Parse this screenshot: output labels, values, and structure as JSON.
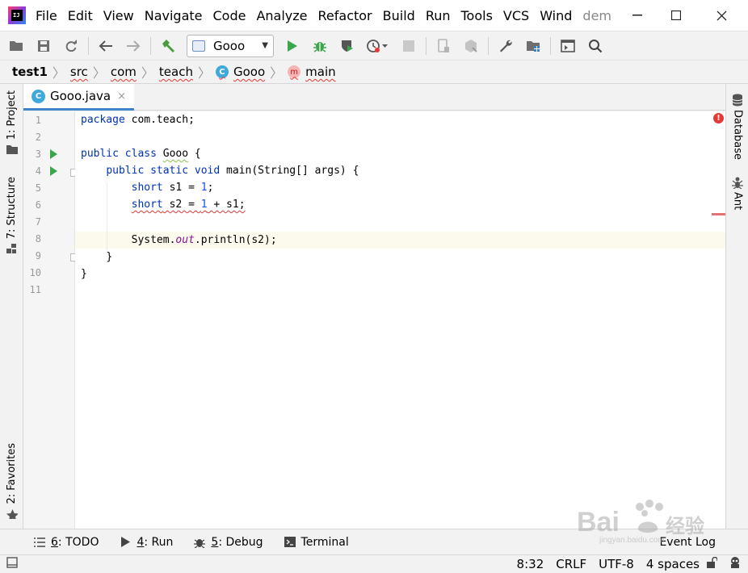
{
  "menubar": {
    "items": [
      "File",
      "Edit",
      "View",
      "Navigate",
      "Code",
      "Analyze",
      "Refactor",
      "Build",
      "Run",
      "Tools",
      "VCS",
      "Wind"
    ],
    "title_fragment": "dem"
  },
  "toolbar": {
    "run_config": "Gooo"
  },
  "breadcrumb": {
    "project": "test1",
    "items": [
      "src",
      "com",
      "teach"
    ],
    "class_badge": "C",
    "class_name": "Gooo",
    "method_badge": "m",
    "method_name": "main"
  },
  "left_stripe": {
    "project": "1: Project",
    "structure": "7: Structure",
    "favorites": "2: Favorites"
  },
  "right_stripe": {
    "database": "Database",
    "ant": "Ant"
  },
  "editor_tab": {
    "badge": "C",
    "filename": "Gooo.java",
    "close": "×"
  },
  "editor": {
    "line_numbers": [
      "1",
      "2",
      "3",
      "4",
      "5",
      "6",
      "7",
      "8",
      "9",
      "10",
      "11"
    ],
    "current_line": 8,
    "error_indicator": "!",
    "code": {
      "l1_kw": "package",
      "l1_rest": " com.teach;",
      "l3_kw": "public class",
      "l3_name": "Gooo",
      "l3_rest": " {",
      "l4_kw": "public static void",
      "l4_rest": " main(String[] args) {",
      "l5_kw": "short",
      "l5_mid": " s1 = ",
      "l5_num": "1",
      "l5_end": ";",
      "l6_kw": "short",
      "l6_mid": " s2 = ",
      "l6_num": "1",
      "l6_end": " + s1;",
      "l8_a": "System.",
      "l8_field": "out",
      "l8_b": ".println(s2);",
      "l9": "}",
      "l10": "}"
    }
  },
  "bottom_bar": {
    "todo_num": "6",
    "todo": ": TODO",
    "run_num": "4",
    "run": ": Run",
    "debug_num": "5",
    "debug": ": Debug",
    "terminal": "Terminal",
    "event_log": "Event Log"
  },
  "status": {
    "position": "8:32",
    "line_sep": "CRLF",
    "encoding": "UTF-8",
    "indent": "4 spaces"
  },
  "watermark": {
    "text": "Bai",
    "cn": "经验",
    "url": "jingyan.baidu.com"
  }
}
